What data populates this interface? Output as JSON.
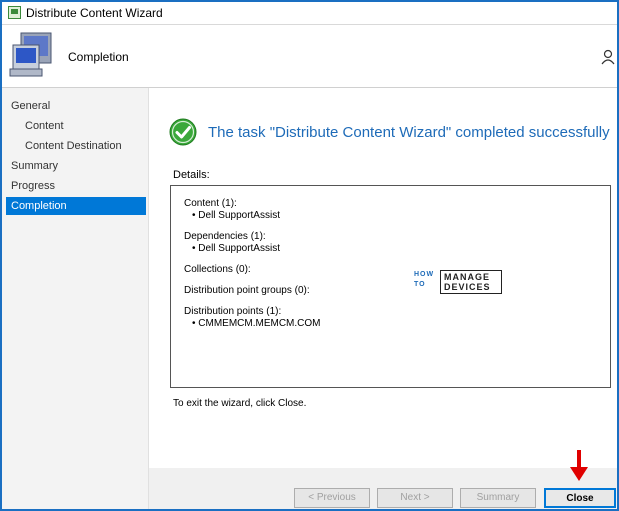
{
  "window": {
    "title": "Distribute Content Wizard"
  },
  "header": {
    "title": "Completion"
  },
  "sidebar": {
    "items": [
      {
        "label": "General"
      },
      {
        "label": "Content"
      },
      {
        "label": "Content Destination"
      },
      {
        "label": "Summary"
      },
      {
        "label": "Progress"
      },
      {
        "label": "Completion"
      }
    ]
  },
  "main": {
    "status_message": "The task \"Distribute Content Wizard\" completed successfully",
    "details_label": "Details:",
    "details": {
      "content_heading": "Content (1):",
      "content_item": "• Dell SupportAssist",
      "dependencies_heading": "Dependencies (1):",
      "dependencies_item": "• Dell SupportAssist",
      "collections_heading": "Collections (0):",
      "dp_groups_heading": "Distribution point groups (0):",
      "dp_heading": "Distribution points (1):",
      "dp_item": "• CMMEMCM.MEMCM.COM"
    },
    "exit_hint": "To exit the wizard, click Close."
  },
  "watermark": {
    "how": "HOW",
    "to": "TO",
    "manage": "MANAGE",
    "devices": "DEVICES"
  },
  "footer": {
    "previous_label": "< Previous",
    "next_label": "Next >",
    "summary_label": "Summary",
    "close_label": "Close"
  },
  "colors": {
    "accent": "#0078d7",
    "success": "#3aa83a",
    "status_text": "#1e6bb8",
    "annotation_arrow": "#e00000"
  }
}
